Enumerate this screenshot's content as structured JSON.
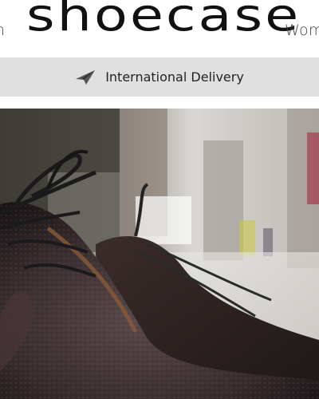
{
  "header": {
    "nav_left_label": "n",
    "logo": "shoecase",
    "nav_right_label": "Wom"
  },
  "banner": {
    "icon": "paper-plane-icon",
    "text": "International Delivery"
  },
  "hero": {
    "subject": "leather-shoes-photo"
  },
  "colors": {
    "banner_bg": "#e0e0e0",
    "logo": "#111111"
  }
}
